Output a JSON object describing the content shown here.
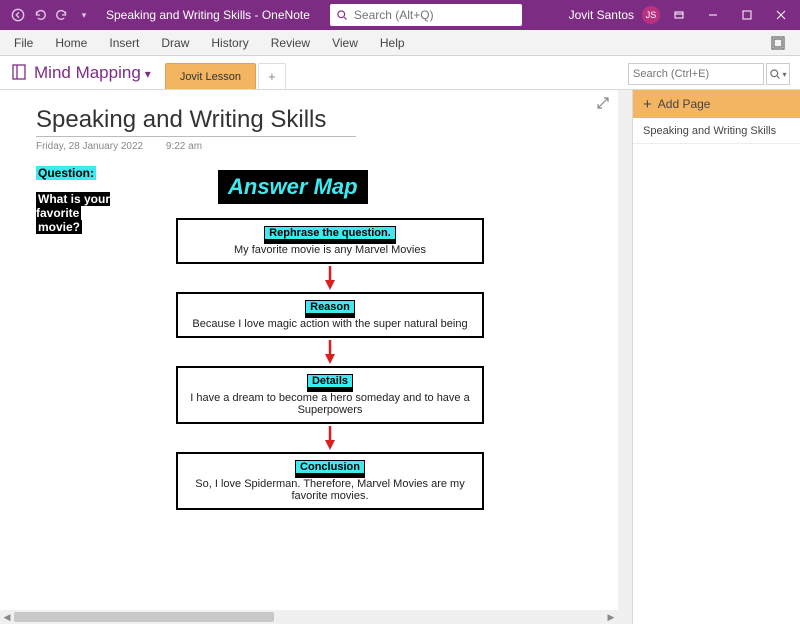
{
  "titlebar": {
    "doc_title": "Speaking and Writing Skills  -  OneNote",
    "search_placeholder": "Search (Alt+Q)",
    "user_name": "Jovit Santos",
    "user_initials": "JS"
  },
  "ribbon": {
    "tabs": [
      "File",
      "Home",
      "Insert",
      "Draw",
      "History",
      "Review",
      "View",
      "Help"
    ]
  },
  "notebook": {
    "name": "Mind Mapping",
    "section_tab": "Jovit Lesson",
    "page_search_placeholder": "Search (Ctrl+E)"
  },
  "page": {
    "title": "Speaking and Writing Skills",
    "date": "Friday, 28 January 2022",
    "time": "9:22 am"
  },
  "content": {
    "question_label": "Question:",
    "question_text_1": "What is your favorite",
    "question_text_2": "movie?",
    "answer_map_title": "Answer Map",
    "boxes": [
      {
        "heading": "Rephrase the question.",
        "text": "My favorite movie is any Marvel Movies"
      },
      {
        "heading": "Reason",
        "text": "Because I love magic action with the super natural being"
      },
      {
        "heading": "Details",
        "text": "I have a  dream to become a hero someday and to have a Superpowers"
      },
      {
        "heading": "Conclusion",
        "text": "So, I love Spiderman. Therefore, Marvel Movies are my favorite movies."
      }
    ]
  },
  "pagepane": {
    "add_page_label": "Add Page",
    "pages": [
      "Speaking and Writing Skills"
    ]
  }
}
